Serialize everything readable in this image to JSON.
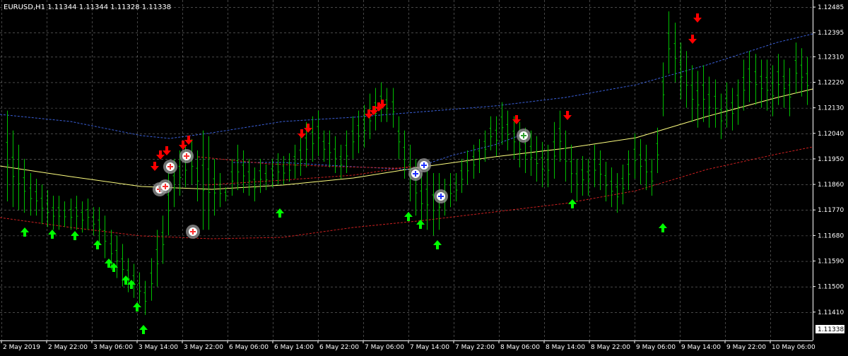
{
  "header": {
    "symbol_line": "EURUSD,H1  1.11344 1.11344 1.11328 1.11338"
  },
  "colors": {
    "background": "#000000",
    "grid": "#c0c0c0",
    "bars": "#00c000",
    "label_bg": "#ffffff",
    "axis_text": "#ffffff",
    "up_arrow": "#00ff00",
    "down_arrow": "#ff0000",
    "ma_yellow": "#ffff80",
    "ma_blue_band": "#3a5fd6",
    "ma_red": "#cc2020",
    "marker_circle": "#9a9a9a"
  },
  "chart_data": {
    "type": "ohlc",
    "symbol": "EURUSD",
    "timeframe": "H1",
    "last_price": "1.11338",
    "ylim": [
      1.1131,
      1.1251
    ],
    "y_ticks": [
      "1.12485",
      "1.12395",
      "1.12310",
      "1.12220",
      "1.12130",
      "1.12040",
      "1.11950",
      "1.11860",
      "1.11770",
      "1.11680",
      "1.11590",
      "1.11500",
      "1.11410"
    ],
    "x_ticks": [
      "2 May 2019",
      "2 May 22:00",
      "3 May 06:00",
      "3 May 14:00",
      "3 May 22:00",
      "6 May 06:00",
      "6 May 14:00",
      "6 May 22:00",
      "7 May 06:00",
      "7 May 14:00",
      "7 May 22:00",
      "8 May 06:00",
      "8 May 14:00",
      "8 May 22:00",
      "9 May 06:00",
      "9 May 14:00",
      "9 May 22:00",
      "10 May 06:00"
    ],
    "bar_count": 140,
    "highs": [
      1.1212,
      1.1205,
      1.12,
      1.1195,
      1.119,
      1.1188,
      1.1186,
      1.1184,
      1.1182,
      1.1182,
      1.118,
      1.1181,
      1.1182,
      1.118,
      1.1181,
      1.1178,
      1.1178,
      1.1175,
      1.117,
      1.1168,
      1.1165,
      1.116,
      1.1158,
      1.1155,
      1.1152,
      1.116,
      1.117,
      1.1175,
      1.119,
      1.1195,
      1.1198,
      1.12,
      1.1202,
      1.1198,
      1.1205,
      1.1203,
      1.1195,
      1.119,
      1.1185,
      1.1195,
      1.12,
      1.1198,
      1.1195,
      1.1192,
      1.1195,
      1.1193,
      1.1195,
      1.1197,
      1.1196,
      1.1197,
      1.12,
      1.1203,
      1.1208,
      1.121,
      1.1212,
      1.1205,
      1.1205,
      1.1203,
      1.12,
      1.1205,
      1.121,
      1.1212,
      1.1214,
      1.1218,
      1.122,
      1.1222,
      1.122,
      1.122,
      1.121,
      1.1205,
      1.12,
      1.1195,
      1.119,
      1.1192,
      1.119,
      1.119,
      1.1188,
      1.119,
      1.119,
      1.1195,
      1.1198,
      1.12,
      1.1202,
      1.1205,
      1.121,
      1.121,
      1.1215,
      1.1212,
      1.121,
      1.1208,
      1.1206,
      1.1205,
      1.1203,
      1.1201,
      1.12,
      1.1208,
      1.1212,
      1.1205,
      1.12,
      1.1195,
      1.1196,
      1.1195,
      1.12,
      1.1198,
      1.1194,
      1.1192,
      1.119,
      1.1193,
      1.1198,
      1.1204,
      1.1202,
      1.12,
      1.1195,
      1.1206,
      1.1229,
      1.1247,
      1.1243,
      1.1236,
      1.1233,
      1.1228,
      1.1226,
      1.1228,
      1.1224,
      1.1223,
      1.1218,
      1.1222,
      1.122,
      1.1223,
      1.123,
      1.1233,
      1.1232,
      1.123,
      1.123,
      1.1228,
      1.1232,
      1.123,
      1.1227,
      1.1236,
      1.1234,
      1.1231
    ],
    "lows": [
      1.118,
      1.1178,
      1.1177,
      1.1176,
      1.1175,
      1.1175,
      1.1172,
      1.1171,
      1.117,
      1.117,
      1.1171,
      1.117,
      1.117,
      1.1169,
      1.117,
      1.1168,
      1.1165,
      1.116,
      1.1156,
      1.1153,
      1.115,
      1.1148,
      1.1146,
      1.1144,
      1.114,
      1.1145,
      1.115,
      1.1158,
      1.1168,
      1.1178,
      1.1182,
      1.1185,
      1.1186,
      1.118,
      1.117,
      1.117,
      1.1175,
      1.1178,
      1.118,
      1.1182,
      1.1184,
      1.1183,
      1.1182,
      1.118,
      1.1183,
      1.1184,
      1.1185,
      1.1186,
      1.1186,
      1.1187,
      1.1188,
      1.1189,
      1.1192,
      1.1194,
      1.1196,
      1.1194,
      1.1192,
      1.119,
      1.1188,
      1.119,
      1.1195,
      1.1197,
      1.1199,
      1.1202,
      1.1205,
      1.1208,
      1.1208,
      1.1206,
      1.1195,
      1.1188,
      1.118,
      1.1175,
      1.1172,
      1.117,
      1.1168,
      1.117,
      1.1175,
      1.1178,
      1.118,
      1.1183,
      1.1186,
      1.1188,
      1.119,
      1.1194,
      1.1198,
      1.1196,
      1.12,
      1.1198,
      1.1195,
      1.1192,
      1.119,
      1.1189,
      1.1187,
      1.1185,
      1.1185,
      1.1188,
      1.1194,
      1.1187,
      1.1183,
      1.118,
      1.1182,
      1.1182,
      1.1185,
      1.1184,
      1.118,
      1.1178,
      1.1176,
      1.1179,
      1.1184,
      1.1188,
      1.1186,
      1.1184,
      1.1182,
      1.119,
      1.121,
      1.1225,
      1.1222,
      1.1216,
      1.1213,
      1.1208,
      1.1206,
      1.1208,
      1.1206,
      1.1206,
      1.1202,
      1.1206,
      1.1205,
      1.1207,
      1.1212,
      1.1215,
      1.1214,
      1.1213,
      1.1212,
      1.121,
      1.1214,
      1.1213,
      1.121,
      1.1218,
      1.1217,
      1.1214
    ]
  }
}
